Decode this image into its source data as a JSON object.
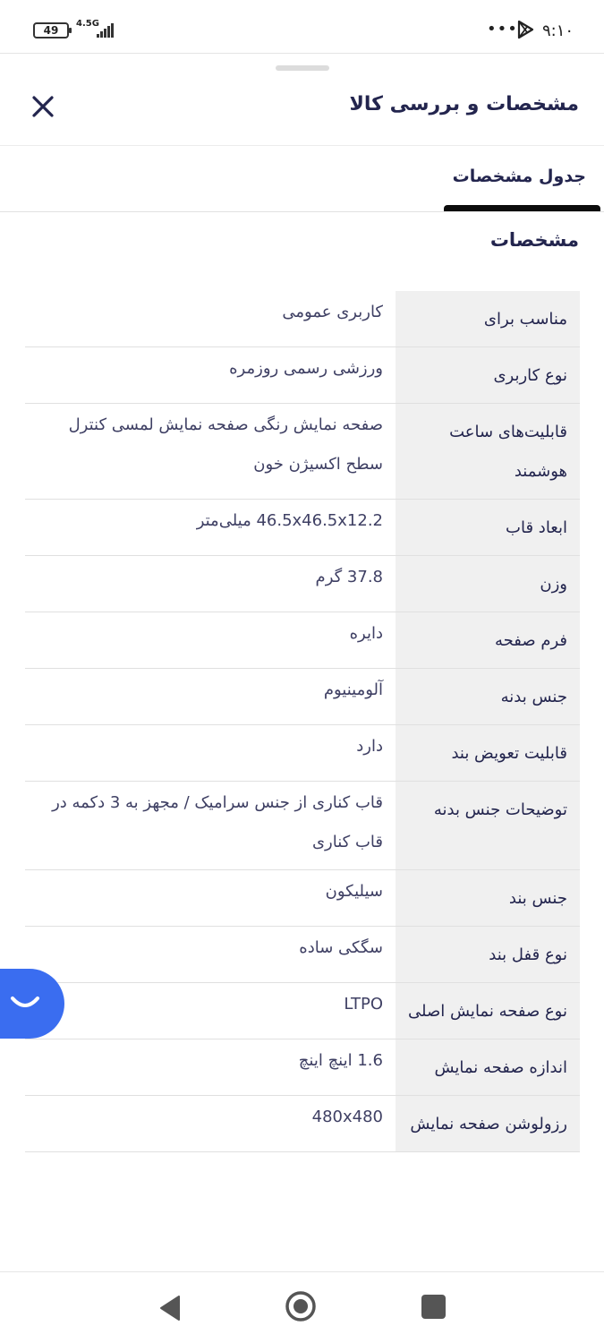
{
  "status_bar": {
    "battery": "49",
    "network": "4.5G",
    "dots": "•••",
    "time": "۹:۱۰"
  },
  "sheet": {
    "title": "مشخصات و بررسی کالا",
    "close_icon": "close-icon"
  },
  "tabs": [
    {
      "label": "جدول مشخصات",
      "active": true
    }
  ],
  "section": {
    "title": "مشخصات"
  },
  "specs": [
    {
      "key": "مناسب برای",
      "value": "کاربری عمومی"
    },
    {
      "key": "نوع کاربری",
      "value": "ورزشی رسمی روزمره"
    },
    {
      "key": "قابلیت‌های ساعت هوشمند",
      "value": "صفحه نمایش رنگی صفحه نمایش لمسی کنترل سطح اکسیژن خون"
    },
    {
      "key": "ابعاد قاب",
      "value": "46.5x46.5x12.2 میلی‌متر"
    },
    {
      "key": "وزن",
      "value": "37.8 گرم"
    },
    {
      "key": "فرم صفحه",
      "value": "دایره"
    },
    {
      "key": "جنس بدنه",
      "value": "آلومینیوم"
    },
    {
      "key": "قابلیت تعویض بند",
      "value": "دارد"
    },
    {
      "key": "توضیحات جنس بدنه",
      "value": "قاب کناری از جنس سرامیک / مجهز به 3 دکمه در قاب کناری"
    },
    {
      "key": "جنس بند",
      "value": "سیلیکون"
    },
    {
      "key": "نوع قفل بند",
      "value": "سگکی ساده"
    },
    {
      "key": "نوع صفحه نمایش اصلی",
      "value": "LTPO"
    },
    {
      "key": "اندازه صفحه نمایش",
      "value": "1.6 اینچ اینچ"
    },
    {
      "key": "رزولوشن صفحه نمایش",
      "value": "480x480"
    }
  ],
  "chat_button": {
    "icon": "chat-smile-icon",
    "color": "#3a6df0"
  },
  "nav_bar": {
    "back_icon": "back-triangle-icon",
    "home_icon": "home-circle-icon",
    "recents_icon": "recents-square-icon"
  }
}
